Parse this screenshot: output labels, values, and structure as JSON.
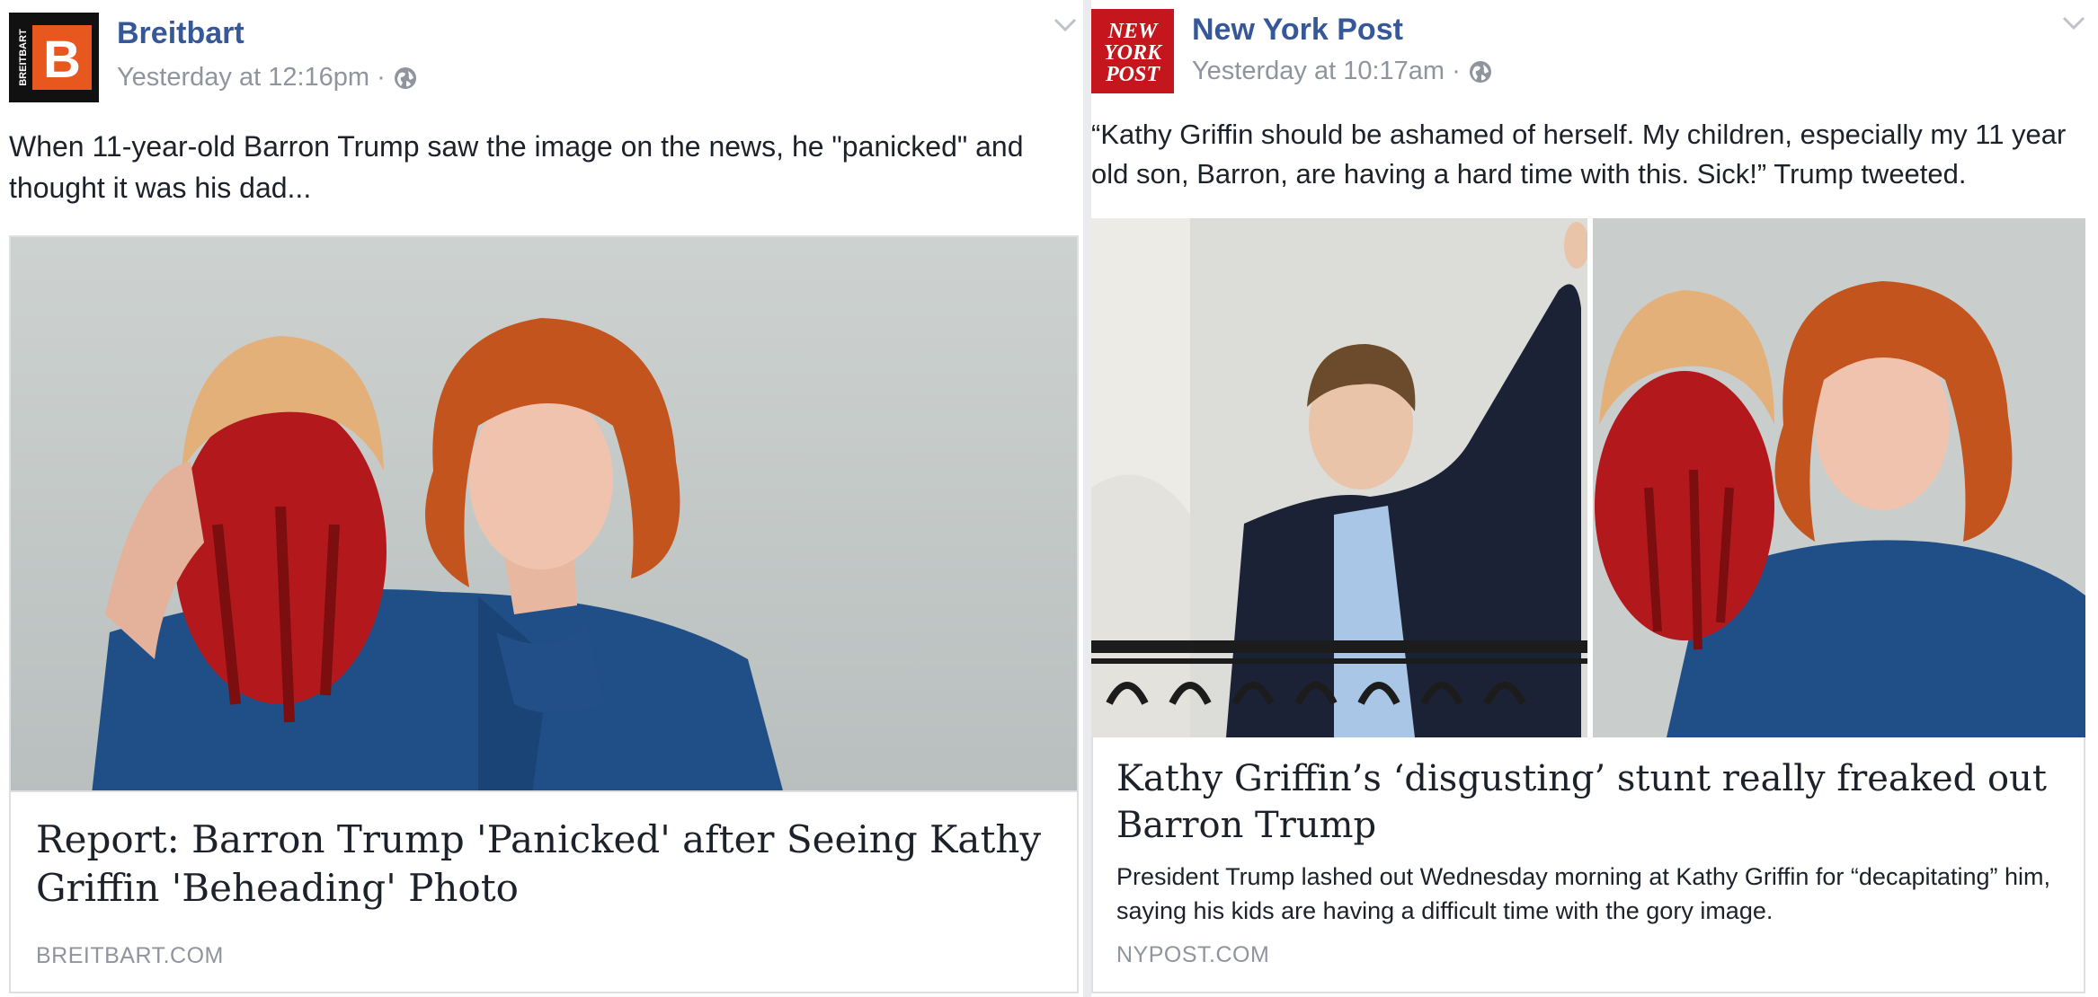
{
  "posts": [
    {
      "page_name": "Breitbart",
      "avatar_text": "B",
      "avatar_sidebar": "BREITBART",
      "timestamp": "Yesterday at 12:16pm",
      "separator": "·",
      "privacy_icon": "globe-icon",
      "menu_icon": "chevron-down-icon",
      "message": "When 11-year-old Barron Trump saw the image on the news, he \"panicked\" and thought it was his dad...",
      "link_title": "Report: Barron Trump 'Panicked' after Seeing Kathy Griffin 'Beheading' Photo",
      "link_domain": "BREITBART.COM"
    },
    {
      "page_name": "New York Post",
      "avatar_lines": [
        "NEW",
        "YORK",
        "POST"
      ],
      "timestamp": "Yesterday at 10:17am",
      "separator": "·",
      "privacy_icon": "globe-icon",
      "menu_icon": "chevron-down-icon",
      "message": "“Kathy Griffin should be ashamed of herself. My children, especially my 11 year old son, Barron, are having a hard time with this. Sick!” Trump tweeted.",
      "link_title": "Kathy Griffin’s ‘disgusting’ stunt really freaked out Barron Trump",
      "link_description": "President Trump lashed out Wednesday morning at Kathy Griffin for “decapitating” him, saying his kids are having a difficult time with the gory image.",
      "link_domain": "NYPOST.COM"
    }
  ],
  "colors": {
    "page_name": "#365899",
    "meta": "#90949c",
    "breitbart_orange": "#e8571e",
    "nypost_red": "#c4161c"
  }
}
